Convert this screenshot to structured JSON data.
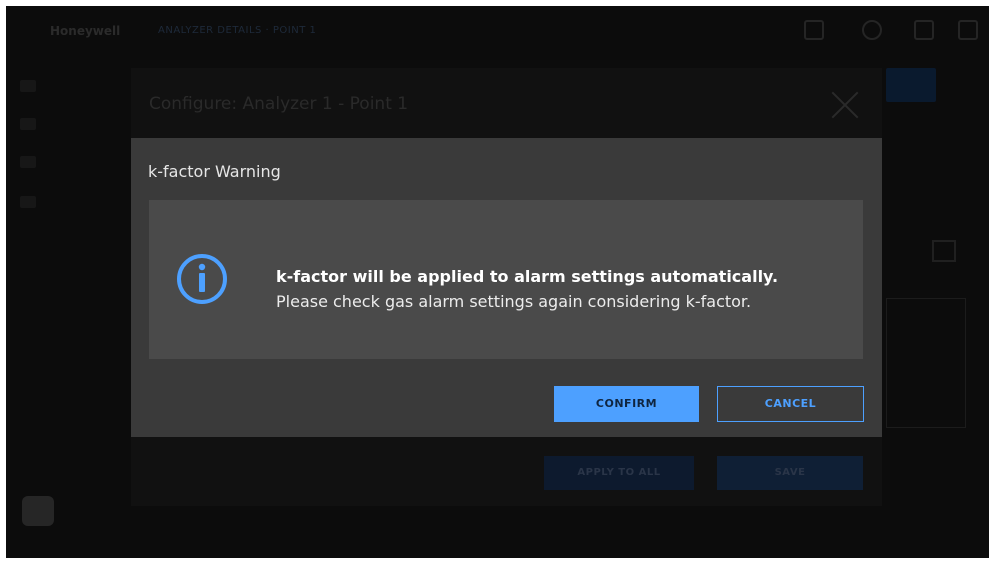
{
  "app": {
    "brand": "Honeywell",
    "breadcrumb": "ANALYZER DETAILS · POINT 1"
  },
  "configure_dialog": {
    "title": "Configure: Analyzer 1 - Point 1",
    "apply_label": "APPLY TO ALL",
    "save_label": "SAVE"
  },
  "warning_dialog": {
    "title": "k-factor Warning",
    "message_bold": "k-factor will be applied to alarm settings automatically.",
    "message": "Please check gas alarm settings again considering k-factor.",
    "icon": "info-icon",
    "confirm_label": "CONFIRM",
    "cancel_label": "CANCEL"
  },
  "colors": {
    "accent": "#4da0ff",
    "dialog_bg": "#3a3a3a",
    "message_bg": "#4a4a4a"
  }
}
